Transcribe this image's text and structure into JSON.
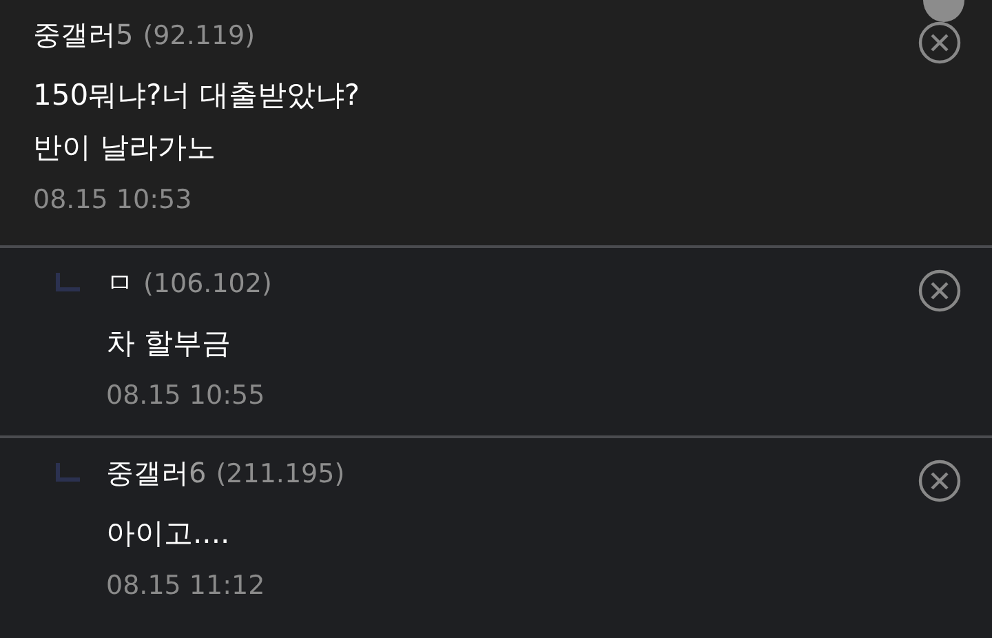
{
  "comments": [
    {
      "kind": "comment",
      "nickname": "중갤러",
      "suffix": "5",
      "ip": "(92.119)",
      "lines": [
        "150뭐냐?너 대출받았냐?",
        "반이 날라가노"
      ],
      "time": "08.15 10:53"
    },
    {
      "kind": "reply",
      "nickname": "ㅁ",
      "ip": "(106.102)",
      "lines": [
        "차 할부금"
      ],
      "time": "08.15 10:55"
    },
    {
      "kind": "reply",
      "nickname": "중갤러",
      "suffix": "6",
      "ip": "(211.195)",
      "lines": [
        "아이고...."
      ],
      "time": "08.15 11:12"
    }
  ]
}
